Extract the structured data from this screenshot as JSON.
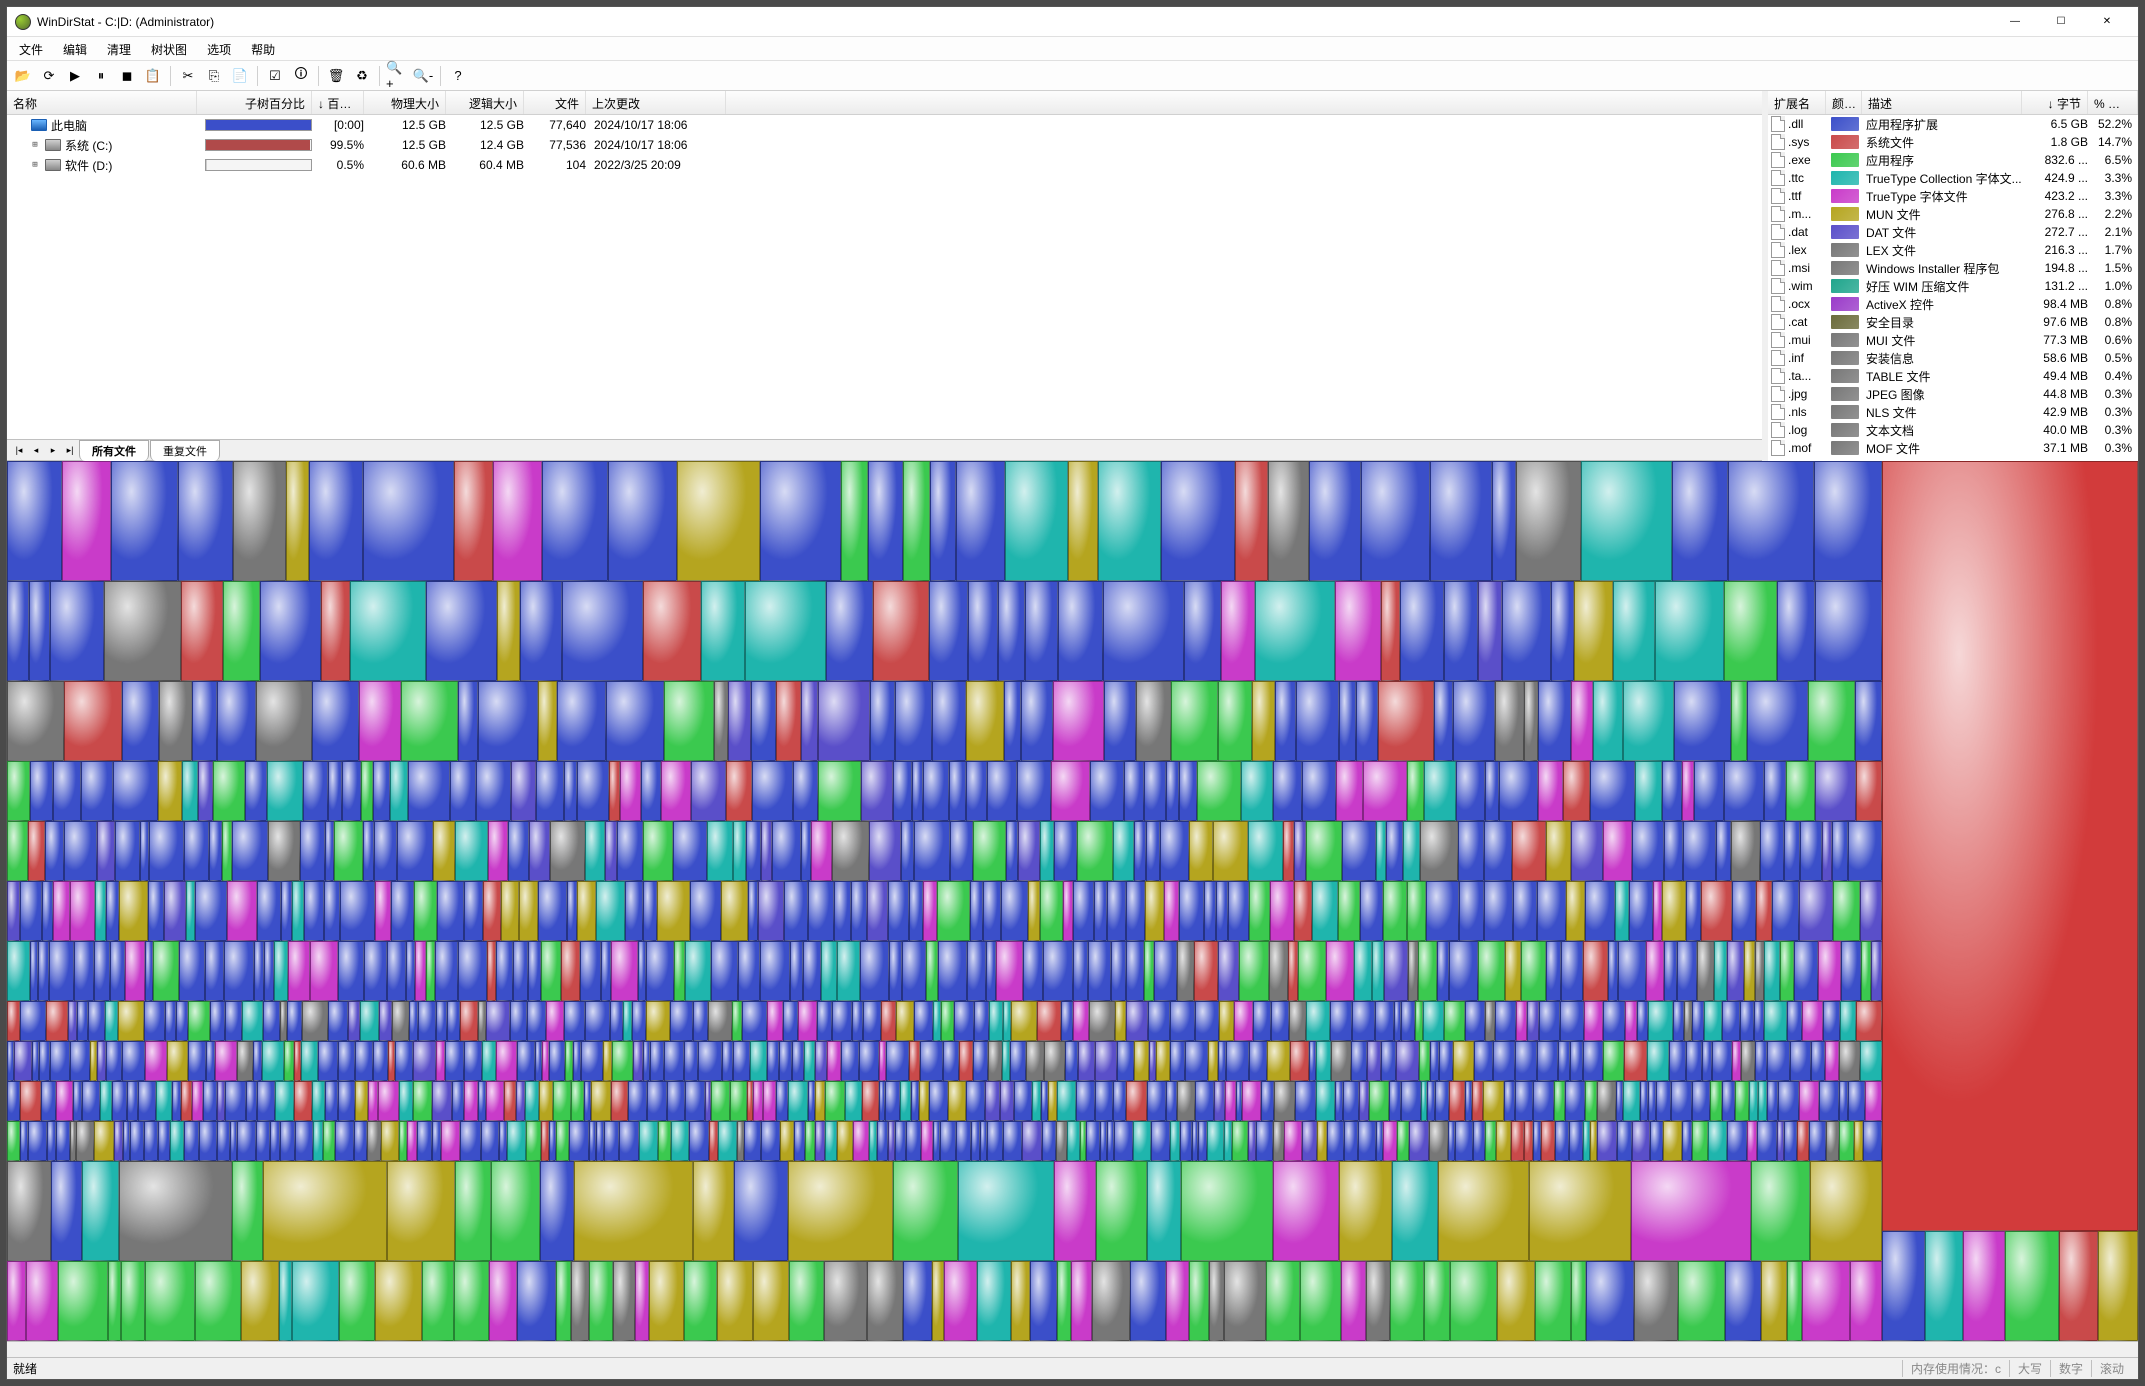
{
  "window": {
    "title": "WinDirStat - C:|D:  (Administrator)"
  },
  "menu": [
    "文件",
    "编辑",
    "清理",
    "树状图",
    "选项",
    "帮助"
  ],
  "toolbar_icons": [
    "open-icon",
    "refresh-icon",
    "play-icon",
    "pause-icon",
    "stop-icon",
    "copy-path-icon",
    "sep",
    "cut-icon",
    "copy-icon",
    "paste-icon",
    "sep",
    "select-icon",
    "properties-icon",
    "sep",
    "delete-icon",
    "recycle-icon",
    "sep",
    "zoom-in-icon",
    "zoom-out-icon",
    "sep",
    "help-icon"
  ],
  "tree": {
    "headers": {
      "name": "名称",
      "bar": "子树百分比",
      "pct": "↓ 百分...",
      "psize": "物理大小",
      "lsize": "逻辑大小",
      "files": "文件",
      "date": "上次更改"
    },
    "rows": [
      {
        "indent": 0,
        "exp": "",
        "icon": "pc",
        "name": "此电脑",
        "bar_color": "#3b4fc9",
        "bar_pct": 100,
        "pct": "[0:00]",
        "psize": "12.5 GB",
        "lsize": "12.5 GB",
        "files": "77,640",
        "date": "2024/10/17  18:06"
      },
      {
        "indent": 1,
        "exp": "+",
        "icon": "drive",
        "name": "系统 (C:)",
        "bar_color": "#b04a4a",
        "bar_pct": 99.5,
        "pct": "99.5%",
        "psize": "12.5 GB",
        "lsize": "12.4 GB",
        "files": "77,536",
        "date": "2024/10/17  18:06"
      },
      {
        "indent": 1,
        "exp": "+",
        "icon": "drive",
        "name": "软件 (D:)",
        "bar_color": "#cccccc",
        "bar_pct": 0.5,
        "pct": "0.5%",
        "psize": "60.6 MB",
        "lsize": "60.4 MB",
        "files": "104",
        "date": "2022/3/25  20:09"
      }
    ]
  },
  "ext": {
    "headers": {
      "ext": "扩展名",
      "color": "颜色",
      "desc": "描述",
      "bytes": "↓ 字节",
      "pct": "% 字节"
    },
    "rows": [
      {
        "ext": ".dll",
        "color": "#3b4fc9",
        "desc": "应用程序扩展",
        "bytes": "6.5 GB",
        "pct": "52.2%"
      },
      {
        "ext": ".sys",
        "color": "#c94a4a",
        "desc": "系统文件",
        "bytes": "1.8 GB",
        "pct": "14.7%"
      },
      {
        "ext": ".exe",
        "color": "#3bc94f",
        "desc": "应用程序",
        "bytes": "832.6 ...",
        "pct": "6.5%"
      },
      {
        "ext": ".ttc",
        "color": "#1fb5ad",
        "desc": "TrueType Collection 字体文...",
        "bytes": "424.9 ...",
        "pct": "3.3%"
      },
      {
        "ext": ".ttf",
        "color": "#c93bc9",
        "desc": "TrueType 字体文件",
        "bytes": "423.2 ...",
        "pct": "3.3%"
      },
      {
        "ext": ".m...",
        "color": "#b5a51f",
        "desc": "MUN 文件",
        "bytes": "276.8 ...",
        "pct": "2.2%"
      },
      {
        "ext": ".dat",
        "color": "#5a4fc9",
        "desc": "DAT 文件",
        "bytes": "272.7 ...",
        "pct": "2.1%"
      },
      {
        "ext": ".lex",
        "color": "#777777",
        "desc": "LEX 文件",
        "bytes": "216.3 ...",
        "pct": "1.7%"
      },
      {
        "ext": ".msi",
        "color": "#777777",
        "desc": "Windows Installer 程序包",
        "bytes": "194.8 ...",
        "pct": "1.5%"
      },
      {
        "ext": ".wim",
        "color": "#1fa58c",
        "desc": "好压 WIM 压缩文件",
        "bytes": "131.2 ...",
        "pct": "1.0%"
      },
      {
        "ext": ".ocx",
        "color": "#9a3bc9",
        "desc": "ActiveX 控件",
        "bytes": "98.4 MB",
        "pct": "0.8%"
      },
      {
        "ext": ".cat",
        "color": "#6b6b3b",
        "desc": "安全目录",
        "bytes": "97.6 MB",
        "pct": "0.8%"
      },
      {
        "ext": ".mui",
        "color": "#777777",
        "desc": "MUI 文件",
        "bytes": "77.3 MB",
        "pct": "0.6%"
      },
      {
        "ext": ".inf",
        "color": "#777777",
        "desc": "安装信息",
        "bytes": "58.6 MB",
        "pct": "0.5%"
      },
      {
        "ext": ".ta...",
        "color": "#777777",
        "desc": "TABLE 文件",
        "bytes": "49.4 MB",
        "pct": "0.4%"
      },
      {
        "ext": ".jpg",
        "color": "#777777",
        "desc": "JPEG 图像",
        "bytes": "44.8 MB",
        "pct": "0.3%"
      },
      {
        "ext": ".nls",
        "color": "#777777",
        "desc": "NLS 文件",
        "bytes": "42.9 MB",
        "pct": "0.3%"
      },
      {
        "ext": ".log",
        "color": "#777777",
        "desc": "文本文档",
        "bytes": "40.0 MB",
        "pct": "0.3%"
      },
      {
        "ext": ".mof",
        "color": "#777777",
        "desc": "MOF 文件",
        "bytes": "37.1 MB",
        "pct": "0.3%"
      }
    ]
  },
  "tabs": {
    "all": "所有文件",
    "dup": "重复文件"
  },
  "status": {
    "ready": "就绪",
    "mem": "内存使用情况：c",
    "caps": "大写",
    "num": "数字",
    "scroll": "滚动"
  },
  "treemap_palette": [
    "#3b4fc9",
    "#1fb5ad",
    "#c93bc9",
    "#3bc94f",
    "#c94a4a",
    "#b5a51f",
    "#777777",
    "#5a4fc9",
    "#9a3bc9",
    "#2e8b57"
  ]
}
